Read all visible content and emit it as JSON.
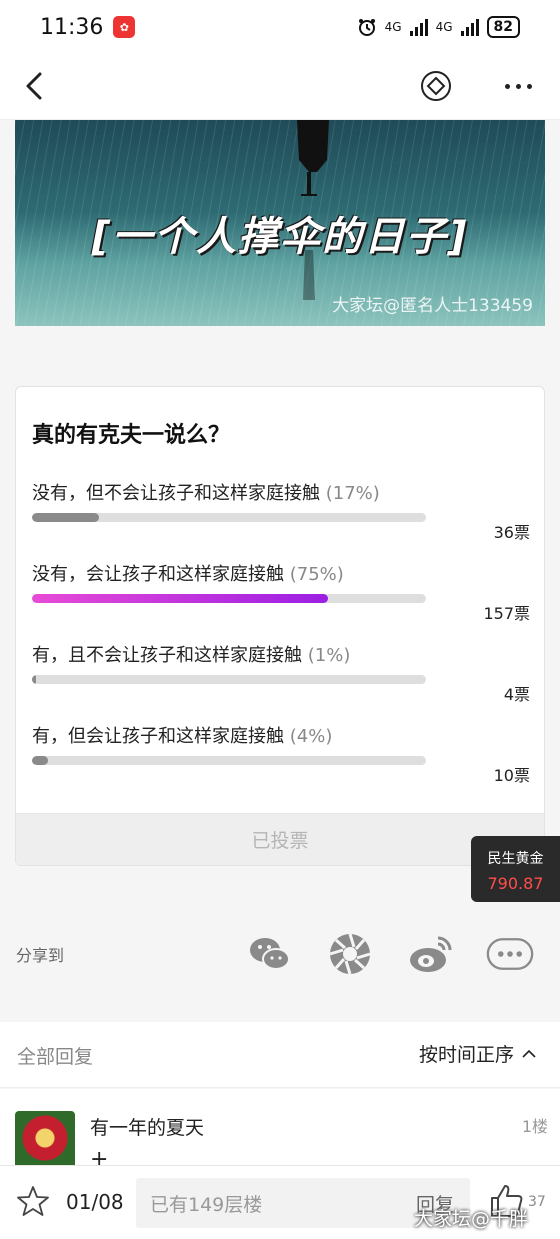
{
  "status": {
    "time": "11:36",
    "network1": "4G",
    "network2": "4G",
    "battery": "82"
  },
  "banner": {
    "title": "[一个人撑伞的日子]",
    "watermark": "大家坛@匿名人士133459"
  },
  "poll": {
    "title": "真的有克夫一说么？",
    "options": [
      {
        "label": "没有，但不会让孩子和这样家庭接触",
        "pct": "(17%)",
        "fraction": 0.17,
        "votes": "36票",
        "selected": false
      },
      {
        "label": "没有，会让孩子和这样家庭接触",
        "pct": "(75%)",
        "fraction": 0.75,
        "votes": "157票",
        "selected": true
      },
      {
        "label": "有，且不会让孩子和这样家庭接触",
        "pct": "(1%)",
        "fraction": 0.01,
        "votes": "4票",
        "selected": false
      },
      {
        "label": "有，但会让孩子和这样家庭接触",
        "pct": "(4%)",
        "fraction": 0.04,
        "votes": "10票",
        "selected": false
      }
    ],
    "voted_label": "已投票"
  },
  "gold_widget": {
    "name": "民生黄金",
    "price": "790.87"
  },
  "share": {
    "label": "分享到",
    "targets": [
      "wechat-icon",
      "moments-icon",
      "weibo-icon",
      "more-icon"
    ]
  },
  "replies": {
    "title": "全部回复",
    "sort_label": "按时间正序",
    "items": [
      {
        "user": "有一年的夏天",
        "floor": "1楼",
        "text": "+"
      }
    ]
  },
  "bottom_bar": {
    "page": "01/08",
    "input_placeholder": "已有149层楼",
    "reply_label": "回复",
    "like_count": "37",
    "watermark": "大家坛@千胖"
  },
  "colors": {
    "selected_fill_start": "#e84bd6",
    "selected_fill_end": "#9b1fe3",
    "gold_price": "#ff4d4d"
  }
}
